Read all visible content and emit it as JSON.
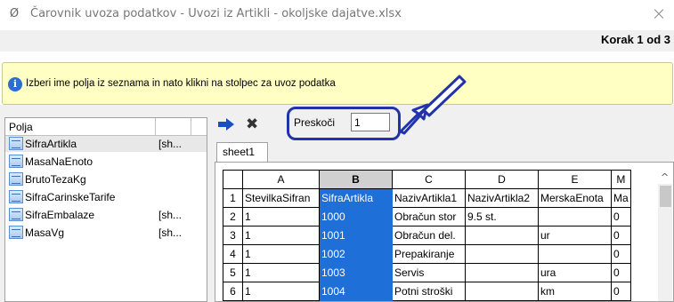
{
  "window": {
    "title": "Čarovnik uvoza podatkov - Uvozi iz Artikli - okoljske dajatve.xlsx",
    "close_label": "×",
    "app_icon_glyph": "Ø"
  },
  "step": {
    "label": "Korak 1 od 3"
  },
  "info": {
    "text": "Izberi ime polja iz seznama in nato klikni na stolpec za uvoz podatka",
    "icon": "info-icon",
    "icon_glyph": "i"
  },
  "fields_panel": {
    "header": "Polja",
    "items": [
      {
        "name": "SifraArtikla",
        "extra": "[sh..."
      },
      {
        "name": "MasaNaEnoto",
        "extra": ""
      },
      {
        "name": "BrutoTezaKg",
        "extra": ""
      },
      {
        "name": "SifraCarinskeTarife",
        "extra": ""
      },
      {
        "name": "SifraEmbalaze",
        "extra": "[sh..."
      },
      {
        "name": "MasaVg",
        "extra": "[sh..."
      }
    ]
  },
  "toolbar": {
    "skip_label": "Preskoči",
    "skip_value": "1",
    "x_glyph": "✖",
    "annotation_color": "#2233aa"
  },
  "sheet": {
    "tab_label": "sheet1",
    "columns": [
      "A",
      "B",
      "C",
      "D",
      "E",
      "M"
    ],
    "rows": [
      {
        "num": "1",
        "cells": [
          "StevilkaSifran",
          "SifraArtikla",
          "NazivArtikla1",
          "NazivArtikla2",
          "MerskaEnota",
          "Ma"
        ]
      },
      {
        "num": "2",
        "cells": [
          "1",
          "1000",
          "Obračun stor",
          "9.5 st.",
          "",
          "0"
        ]
      },
      {
        "num": "3",
        "cells": [
          "1",
          "1001",
          "Obračun del.",
          "",
          "ur",
          "0"
        ]
      },
      {
        "num": "4",
        "cells": [
          "1",
          "1002",
          "Prepakiranje",
          "",
          "",
          "0"
        ]
      },
      {
        "num": "5",
        "cells": [
          "1",
          "1003",
          "Servis",
          "",
          "ura",
          "0"
        ]
      },
      {
        "num": "6",
        "cells": [
          "1",
          "1004",
          "Potni stroški",
          "",
          "km",
          "0"
        ]
      }
    ],
    "selected_column": "B",
    "selected_color": "#1e6fd8"
  }
}
